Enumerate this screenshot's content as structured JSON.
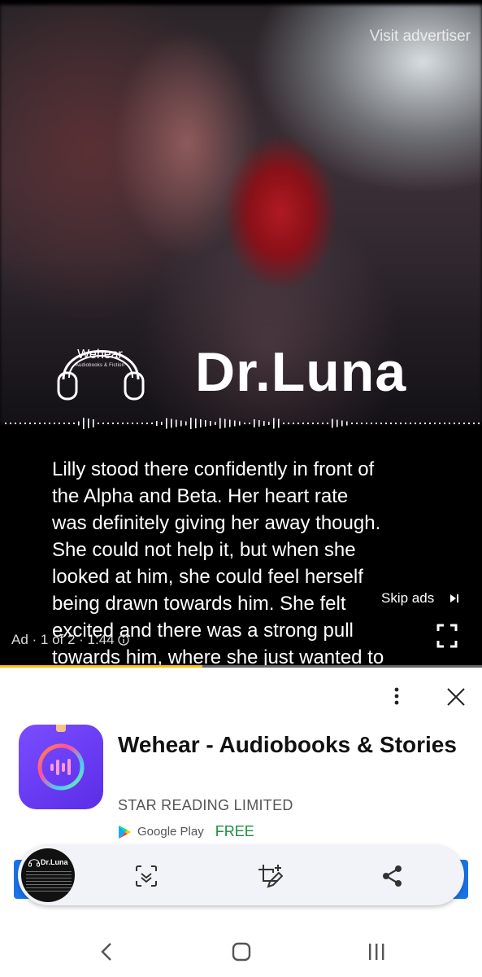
{
  "video": {
    "visit_advertiser": "Visit advertiser",
    "logo_word": "Wehear",
    "logo_sub": "Audiobooks & Fiction",
    "title": "Dr.Luna",
    "story_text": "Lilly stood there confidently in front of\nthe Alpha and Beta. Her heart rate\nwas definitely giving her away though.\nShe could not help it, but when she\nlooked at him, she could feel herself\nbeing drawn towards him. She felt\nexcited and there was a strong pull\ntowards him, where she just wanted to",
    "skip_ads": "Skip ads",
    "ad_info": "Ad · 1 of 2 · 1:44",
    "progress_fraction": 0.42,
    "icons": {
      "skip": "skip-next-icon",
      "info": "info-icon",
      "fullscreen": "fullscreen-icon"
    }
  },
  "ad_card": {
    "app_name": "Wehear - Audiobooks & Stories",
    "developer": "STAR READING LIMITED",
    "store_label": "Google Play",
    "price": "FREE",
    "icons": {
      "more": "more-vert-icon",
      "close": "close-icon",
      "app": "wehear-app-icon",
      "store": "google-play-icon"
    }
  },
  "toolbar": {
    "thumb_title": "Dr.Luna",
    "icons": [
      "scroll-capture-icon",
      "crop-edit-icon",
      "share-icon"
    ]
  },
  "navbar": {
    "icons": [
      "back-icon",
      "home-icon",
      "recent-apps-icon"
    ]
  },
  "colors": {
    "accent_yellow": "#f5c400",
    "play_green": "#1e8e3e",
    "brand_purple": "#6a3df5",
    "install_blue": "#1a73e8"
  }
}
